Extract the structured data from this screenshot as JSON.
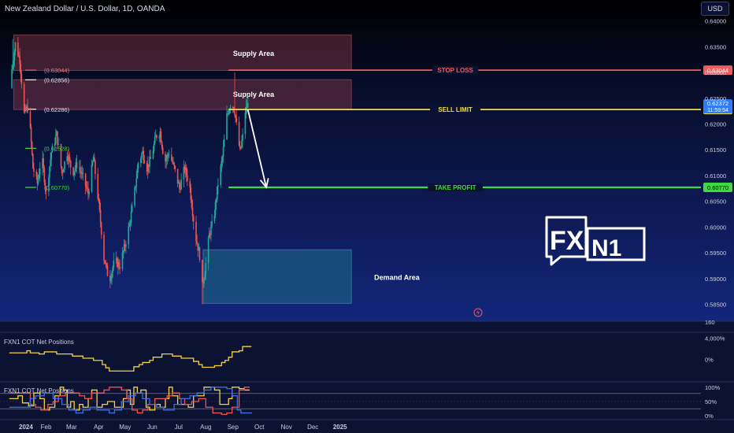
{
  "header": {
    "symbol_title": "New Zealand Dollar / U.S. Dollar, 1D, OANDA",
    "currency_button": "USD"
  },
  "annotations": {
    "supply_upper": "Supply Area",
    "supply_lower": "Supply Area",
    "demand": "Demand Area",
    "stop_loss": "STOP LOSS",
    "sell_limit": "SELL LIMIT",
    "take_profit": "TAKE PROFIT",
    "logo": "FXN1"
  },
  "colors": {
    "background": "#0b1130",
    "up_candle": "#26a69a",
    "down_candle": "#ef5350",
    "stop_loss": "#f05a5a",
    "sell_limit": "#f2e03a",
    "take_profit": "#3ddc3d",
    "supply_zone": "#8a3a4c",
    "demand_zone": "#1f6d86",
    "cot_yellow": "#f5d142",
    "cot_red": "#ef5350",
    "cot_blue": "#3f6fe6"
  },
  "chart_data": [
    {
      "type": "candlestick",
      "instrument": "New Zealand Dollar / U.S. Dollar, 1D, OANDA",
      "x_labels": [
        "2024",
        "Feb",
        "Mar",
        "Apr",
        "May",
        "Jun",
        "Jul",
        "Aug",
        "Sep",
        "Oct",
        "Nov",
        "Dec",
        "2025"
      ],
      "x_label_days": [
        1,
        32,
        61,
        92,
        122,
        153,
        183,
        214,
        245,
        275,
        306,
        336,
        367
      ],
      "ylim": [
        0.5825,
        0.641
      ],
      "y_ticks": [
        0.64,
        0.635,
        0.63,
        0.625,
        0.62,
        0.615,
        0.61,
        0.605,
        0.6,
        0.595,
        0.59,
        0.585
      ],
      "y_tick_labels": [
        "0.64000",
        "0.63500",
        "0.63000",
        "0.62500",
        "0.62000",
        "0.61500",
        "0.61000",
        "0.60500",
        "0.60000",
        "0.59500",
        "0.59000",
        "0.58500"
      ],
      "close_path": [
        [
          -10,
          0.627
        ],
        [
          -3,
          0.6355
        ],
        [
          2,
          0.6325
        ],
        [
          7,
          0.622
        ],
        [
          12,
          0.6235
        ],
        [
          17,
          0.6115
        ],
        [
          22,
          0.6085
        ],
        [
          27,
          0.614
        ],
        [
          32,
          0.6065
        ],
        [
          38,
          0.6145
        ],
        [
          44,
          0.618
        ],
        [
          50,
          0.6105
        ],
        [
          56,
          0.6145
        ],
        [
          62,
          0.6105
        ],
        [
          68,
          0.6125
        ],
        [
          74,
          0.6095
        ],
        [
          80,
          0.6065
        ],
        [
          86,
          0.6135
        ],
        [
          92,
          0.6045
        ],
        [
          98,
          0.594
        ],
        [
          104,
          0.5895
        ],
        [
          110,
          0.5935
        ],
        [
          116,
          0.5925
        ],
        [
          122,
          0.5965
        ],
        [
          127,
          0.6005
        ],
        [
          132,
          0.6055
        ],
        [
          137,
          0.6125
        ],
        [
          142,
          0.6145
        ],
        [
          147,
          0.6115
        ],
        [
          152,
          0.6135
        ],
        [
          157,
          0.6175
        ],
        [
          162,
          0.6185
        ],
        [
          167,
          0.6125
        ],
        [
          172,
          0.6145
        ],
        [
          178,
          0.6115
        ],
        [
          184,
          0.6075
        ],
        [
          190,
          0.6115
        ],
        [
          196,
          0.6075
        ],
        [
          202,
          0.5985
        ],
        [
          207,
          0.5945
        ],
        [
          210,
          0.5885
        ],
        [
          213,
          0.5915
        ],
        [
          218,
          0.5985
        ],
        [
          223,
          0.6015
        ],
        [
          228,
          0.6085
        ],
        [
          233,
          0.6135
        ],
        [
          238,
          0.6215
        ],
        [
          243,
          0.6245
        ],
        [
          247,
          0.6225
        ],
        [
          250,
          0.6185
        ],
        [
          253,
          0.6145
        ],
        [
          256,
          0.6175
        ],
        [
          259,
          0.6225
        ],
        [
          262,
          0.6237
        ]
      ],
      "extremes": [
        {
          "x": -6,
          "high": 0.6365
        },
        {
          "x": 104,
          "low": 0.5855
        },
        {
          "x": 210,
          "low": 0.585
        },
        {
          "x": 247,
          "high": 0.63
        }
      ],
      "zones": [
        {
          "name": "Supply Area",
          "kind": "supply",
          "from": -5,
          "to": 380,
          "y_low": 0.6304,
          "y_high": 0.6373
        },
        {
          "name": "Supply Area",
          "kind": "supply",
          "from": -5,
          "to": 380,
          "y_low": 0.6228,
          "y_high": 0.6286
        },
        {
          "name": "Demand Area",
          "kind": "demand",
          "from": 211,
          "to": 380,
          "y_low": 0.5852,
          "y_high": 0.5956
        }
      ],
      "levels": [
        {
          "label": "STOP LOSS",
          "price": 0.63044,
          "price_label": "0.63044",
          "from": 240,
          "kind": "stop"
        },
        {
          "label": "SELL LIMIT",
          "price": 0.6228,
          "price_label": "0.62280",
          "from": 240,
          "kind": "sell"
        },
        {
          "label": "TAKE PROFIT",
          "price": 0.6077,
          "price_label": "0.60770",
          "from": 240,
          "kind": "tp"
        }
      ],
      "fib_levels": [
        {
          "label": "(0.63044)",
          "price": 0.63044
        },
        {
          "label": "(0.62856)",
          "price": 0.62856
        },
        {
          "label": "(0.62286)",
          "price": 0.62286
        },
        {
          "label": "(0.61528)",
          "price": 0.61528
        },
        {
          "label": "(0.60770)",
          "price": 0.6077
        }
      ],
      "last_price": {
        "price": 0.62372,
        "price_label": "0.62372",
        "countdown": "11:59:54"
      },
      "arrow": {
        "from": [
          262,
          0.6228
        ],
        "to": [
          283,
          0.6077
        ]
      }
    },
    {
      "type": "line",
      "title": "FXN1 COT Net Positions",
      "ylim": [
        -35,
        45
      ],
      "y_ticks": [
        40,
        0
      ],
      "y_tick_labels": [
        "4,000%",
        "0%"
      ],
      "top_axis_label": "160",
      "series": [
        {
          "color": "yellow",
          "x": [
            -10,
            3,
            10,
            14,
            24,
            30,
            40,
            44,
            58,
            62,
            70,
            74,
            82,
            86,
            92,
            96,
            100,
            104,
            126,
            132,
            138,
            142,
            150,
            154,
            160,
            164,
            172,
            176,
            182,
            186,
            196,
            200,
            206,
            210,
            220,
            224,
            232,
            236,
            240,
            244,
            252,
            256,
            266
          ],
          "values": [
            12,
            12,
            16,
            12,
            10,
            14,
            14,
            10,
            10,
            6,
            6,
            2,
            2,
            -2,
            -2,
            -10,
            -16,
            -22,
            -22,
            -14,
            -10,
            -6,
            -2,
            4,
            4,
            10,
            10,
            6,
            6,
            2,
            2,
            -4,
            -10,
            -15,
            -15,
            -12,
            -6,
            -2,
            4,
            14,
            16,
            24,
            24
          ]
        }
      ]
    },
    {
      "type": "line",
      "title": "FXN1 COT Net Positions",
      "ylim": [
        -5,
        105
      ],
      "y_ticks": [
        100,
        50,
        0
      ],
      "y_tick_labels": [
        "100%",
        "50%",
        "0%"
      ],
      "series": [
        {
          "color": "yellow",
          "x": [
            -10,
            0,
            5,
            12,
            18,
            25,
            30,
            36,
            42,
            48,
            52,
            56,
            60,
            64,
            70,
            74,
            80,
            84,
            90,
            96,
            102,
            110,
            116,
            120,
            124,
            128,
            132,
            136,
            140,
            146,
            150,
            156,
            162,
            168,
            172,
            176,
            182,
            188,
            194,
            200,
            206,
            212,
            218,
            224,
            230,
            236,
            240,
            244,
            252,
            258,
            264
          ],
          "values": [
            60,
            70,
            45,
            35,
            80,
            60,
            20,
            30,
            70,
            100,
            90,
            30,
            50,
            20,
            40,
            30,
            60,
            90,
            30,
            40,
            50,
            30,
            30,
            60,
            90,
            40,
            100,
            80,
            90,
            30,
            20,
            40,
            30,
            60,
            100,
            70,
            40,
            40,
            30,
            70,
            70,
            100,
            100,
            90,
            40,
            40,
            60,
            100,
            95,
            90,
            90
          ]
        },
        {
          "color": "red",
          "x": [
            -10,
            10,
            14,
            20,
            26,
            34,
            40,
            46,
            54,
            62,
            70,
            76,
            84,
            92,
            98,
            104,
            112,
            118,
            124,
            130,
            136,
            142,
            148,
            156,
            162,
            170,
            176,
            184,
            190,
            198,
            206,
            214,
            222,
            232,
            238,
            244,
            252,
            258,
            264
          ],
          "values": [
            80,
            80,
            40,
            30,
            20,
            40,
            50,
            70,
            80,
            80,
            70,
            60,
            80,
            80,
            90,
            100,
            100,
            90,
            60,
            20,
            10,
            20,
            40,
            60,
            60,
            70,
            80,
            60,
            40,
            50,
            60,
            30,
            10,
            5,
            10,
            30,
            90,
            100,
            100
          ]
        },
        {
          "color": "blue",
          "x": [
            -10,
            8,
            14,
            20,
            30,
            40,
            50,
            58,
            66,
            74,
            82,
            90,
            98,
            104,
            110,
            118,
            126,
            134,
            142,
            150,
            158,
            166,
            172,
            178,
            186,
            196,
            204,
            212,
            220,
            230,
            238,
            244,
            250,
            254,
            266
          ],
          "values": [
            30,
            30,
            60,
            70,
            80,
            60,
            40,
            20,
            10,
            20,
            30,
            20,
            20,
            10,
            20,
            50,
            70,
            80,
            60,
            40,
            30,
            20,
            20,
            40,
            60,
            70,
            80,
            90,
            100,
            100,
            95,
            70,
            20,
            10,
            12
          ]
        }
      ]
    }
  ]
}
